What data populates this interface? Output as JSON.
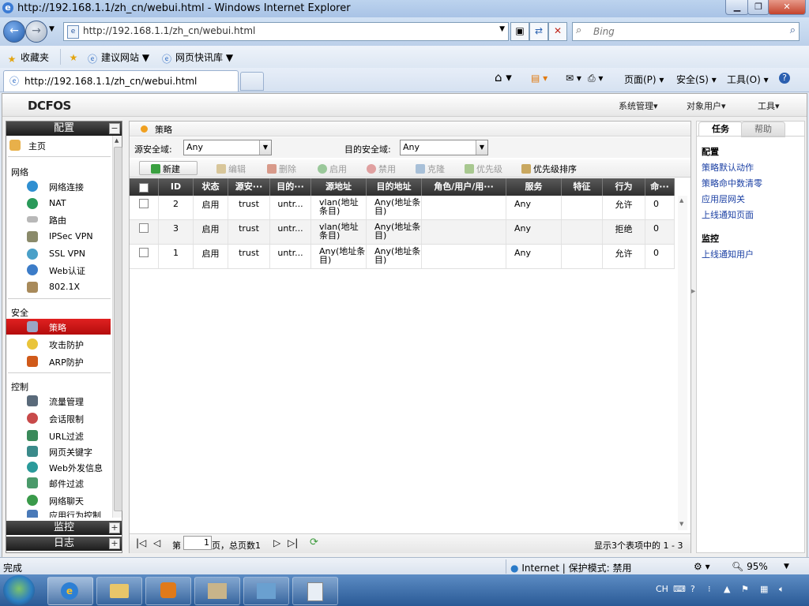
{
  "window": {
    "title": "http://192.168.1.1/zh_cn/webui.html - Windows Internet Explorer"
  },
  "address": {
    "url": "http://192.168.1.1/zh_cn/webui.html",
    "search_placeholder": "Bing"
  },
  "favorites": {
    "label": "收藏夹",
    "suggested": "建议网站",
    "gallery": "网页快讯库"
  },
  "tab": {
    "label": "http://192.168.1.1/zh_cn/webui.html"
  },
  "commands": {
    "page": "页面(P)",
    "safety": "安全(S)",
    "tools": "工具(O)"
  },
  "app": {
    "logo": "DCFOS",
    "menu": [
      "系统管理",
      "对象用户",
      "工具"
    ]
  },
  "sidebar": {
    "config_header": "配置",
    "home": "主页",
    "sections": {
      "network": "网络",
      "security": "安全",
      "control": "控制"
    },
    "network_items": [
      "网络连接",
      "NAT",
      "路由",
      "IPSec VPN",
      "SSL VPN",
      "Web认证",
      "802.1X"
    ],
    "security_items": [
      "策略",
      "攻击防护",
      "ARP防护"
    ],
    "control_items": [
      "流量管理",
      "会话限制",
      "URL过滤",
      "网页关键字",
      "Web外发信息",
      "邮件过滤",
      "网络聊天",
      "应用行为控制"
    ],
    "monitor_header": "监控",
    "log_header": "日志"
  },
  "main": {
    "title": "策略",
    "src_zone_label": "源安全域:",
    "src_zone_value": "Any",
    "dst_zone_label": "目的安全域:",
    "dst_zone_value": "Any",
    "toolbar": {
      "new": "新建",
      "edit": "编辑",
      "delete": "删除",
      "enable": "启用",
      "disable": "禁用",
      "clone": "克隆",
      "priority": "优先级",
      "priority_sort": "优先级排序"
    },
    "columns": [
      "ID",
      "状态",
      "源安···",
      "目的···",
      "源地址",
      "目的地址",
      "角色/用户/用···",
      "服务",
      "特征",
      "行为",
      "命···"
    ],
    "rows": [
      {
        "id": "2",
        "status": "启用",
        "src": "trust",
        "dst": "untr...",
        "src_addr": "vlan(地址条目)",
        "dst_addr": "Any(地址条目)",
        "role": "",
        "service": "Any",
        "feature": "",
        "action": "允许",
        "hits": "0"
      },
      {
        "id": "3",
        "status": "启用",
        "src": "trust",
        "dst": "untr...",
        "src_addr": "vlan(地址条目)",
        "dst_addr": "Any(地址条目)",
        "role": "",
        "service": "Any",
        "feature": "",
        "action": "拒绝",
        "hits": "0"
      },
      {
        "id": "1",
        "status": "启用",
        "src": "trust",
        "dst": "untr...",
        "src_addr": "Any(地址条目)",
        "dst_addr": "Any(地址条目)",
        "role": "",
        "service": "Any",
        "feature": "",
        "action": "允许",
        "hits": "0"
      }
    ],
    "pager": {
      "page_prefix": "第",
      "page_value": "1",
      "page_suffix": "页，总页数1",
      "summary": "显示3个表项中的 1 - 3"
    }
  },
  "right_panel": {
    "tab_tasks": "任务",
    "tab_help": "帮助",
    "config_title": "配置",
    "config_links": [
      "策略默认动作",
      "策略命中数清零",
      "应用层网关",
      "上线通知页面"
    ],
    "monitor_title": "监控",
    "monitor_links": [
      "上线通知用户"
    ]
  },
  "statusbar": {
    "left": "完成",
    "zone": "Internet | 保护模式: 禁用",
    "zoom": "95%"
  },
  "taskbar": {
    "lang": "CH"
  },
  "colors": {
    "active_red": "#c8141a",
    "link": "#1a3fa3",
    "header_dark": "#2e2e2e"
  }
}
